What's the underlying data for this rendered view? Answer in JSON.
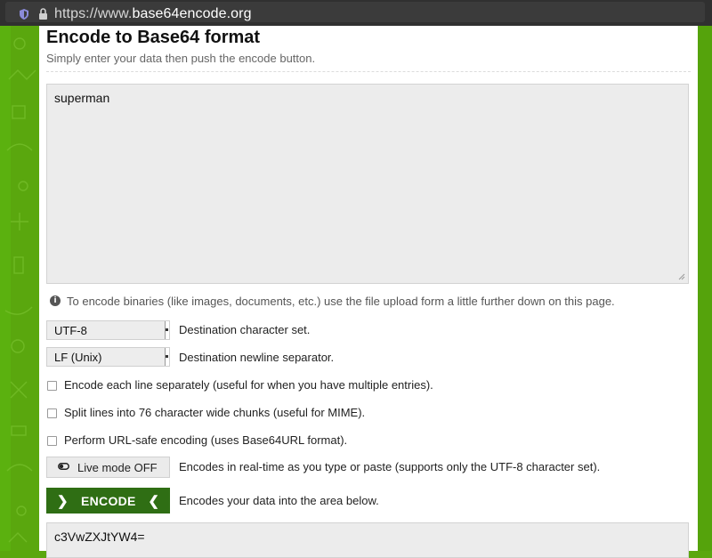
{
  "browser": {
    "url_prefix": "https://www.",
    "url_host": "base64encode.org"
  },
  "page": {
    "title": "Encode to Base64 format",
    "subtitle": "Simply enter your data then push the encode button.",
    "input_value": "superman",
    "info_text": "To encode binaries (like images, documents, etc.) use the file upload form a little further down on this page.",
    "charset": {
      "value": "UTF-8",
      "label": "Destination character set."
    },
    "newline": {
      "value": "LF (Unix)",
      "label": "Destination newline separator."
    },
    "options": [
      {
        "label": "Encode each line separately (useful for when you have multiple entries).",
        "checked": false
      },
      {
        "label": "Split lines into 76 character wide chunks (useful for MIME).",
        "checked": false
      },
      {
        "label": "Perform URL-safe encoding (uses Base64URL format).",
        "checked": false
      }
    ],
    "live_mode": {
      "label": "Live mode OFF",
      "desc": "Encodes in real-time as you type or paste (supports only the UTF-8 character set)."
    },
    "encode": {
      "label": "ENCODE",
      "desc": "Encodes your data into the area below."
    },
    "output_value": "c3VwZXJtYW4="
  },
  "colors": {
    "brand_green": "#5aa70e",
    "button_green": "#2f6e14"
  }
}
